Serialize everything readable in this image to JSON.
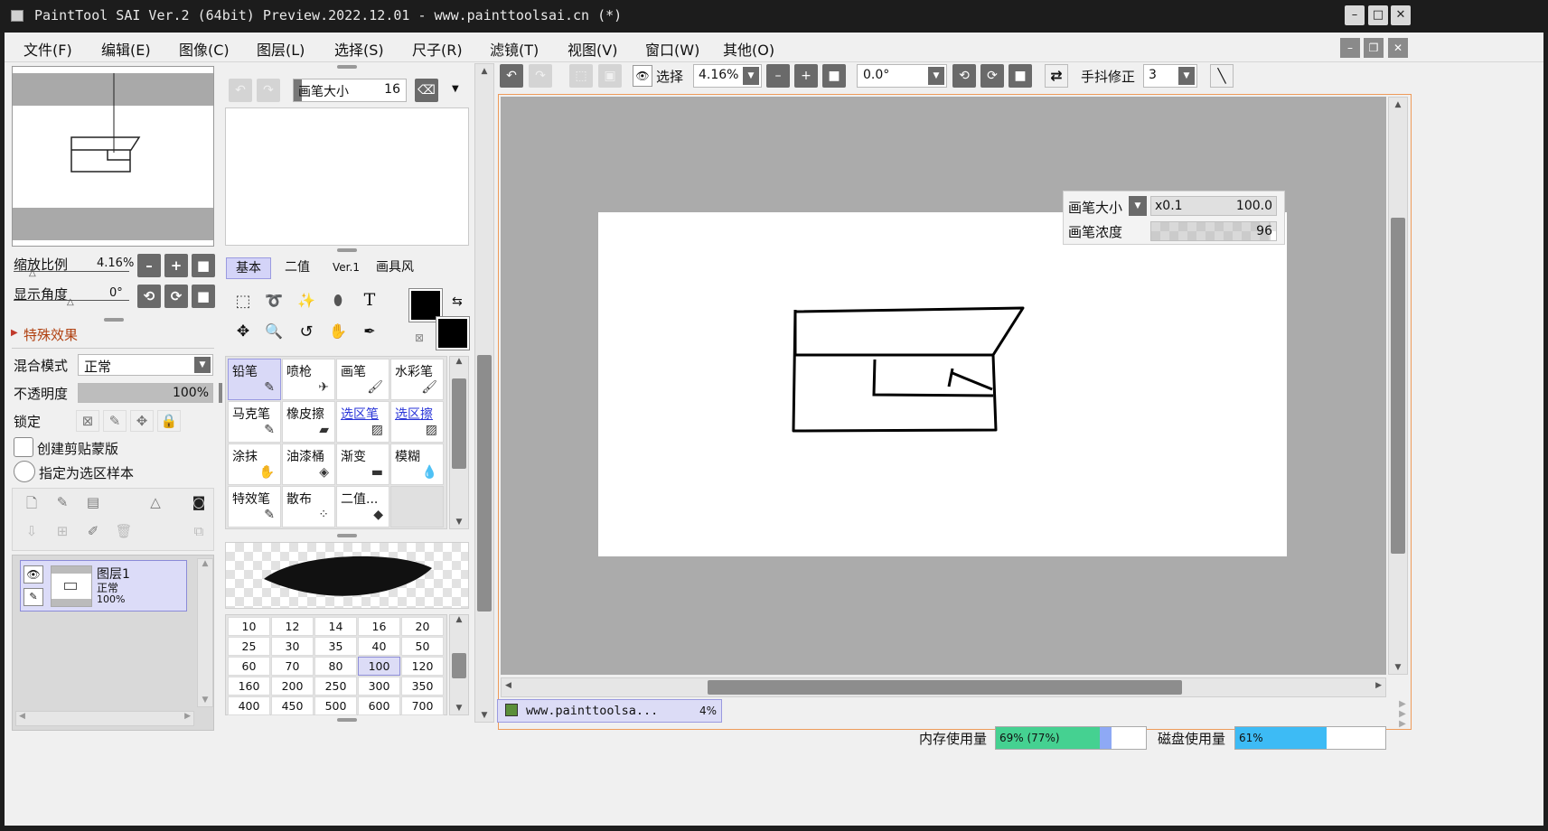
{
  "window": {
    "title": "PaintTool SAI Ver.2 (64bit) Preview.2022.12.01 - www.painttoolsai.cn (*)",
    "minimize": "–",
    "maximize": "□",
    "close": "✕"
  },
  "menu": [
    "文件(F)",
    "编辑(E)",
    "图像(C)",
    "图层(L)",
    "选择(S)",
    "尺子(R)",
    "滤镜(T)",
    "视图(V)",
    "窗口(W)",
    "其他(O)"
  ],
  "navigator": {
    "zoom_label": "缩放比例",
    "zoom_value": "4.16%",
    "angle_label": "显示角度",
    "angle_value": "0°"
  },
  "effects": {
    "label": "特殊效果"
  },
  "layer_props": {
    "blend_label": "混合模式",
    "blend_value": "正常",
    "opacity_label": "不透明度",
    "opacity_value": "100%",
    "opacity": 1.0,
    "lock_label": "锁定",
    "clip_label": "创建剪贴蒙版",
    "sample_label": "指定为选区样本"
  },
  "layers": [
    {
      "name": "图层1",
      "mode": "正常",
      "opacity": "100%"
    }
  ],
  "brush_panel": {
    "size_label": "画笔大小",
    "size_value": "16"
  },
  "tool_tabs": [
    "基本",
    "二值",
    "Ver.1",
    "画具风"
  ],
  "tools": [
    {
      "name": "铅笔",
      "icon": "✎"
    },
    {
      "name": "喷枪",
      "icon": "✈"
    },
    {
      "name": "画笔",
      "icon": "🖌"
    },
    {
      "name": "水彩笔",
      "icon": "🖌"
    },
    {
      "name": "马克笔",
      "icon": "✎"
    },
    {
      "name": "橡皮擦",
      "icon": "▰"
    },
    {
      "name": "选区笔",
      "icon": "▨"
    },
    {
      "name": "选区擦",
      "icon": "▨"
    },
    {
      "name": "涂抹",
      "icon": "✋"
    },
    {
      "name": "油漆桶",
      "icon": "◈"
    },
    {
      "name": "渐变",
      "icon": "▬"
    },
    {
      "name": "模糊",
      "icon": "💧"
    },
    {
      "name": "特效笔",
      "icon": "✎"
    },
    {
      "name": "散布",
      "icon": "⁘"
    },
    {
      "name": "二值...",
      "icon": "◆"
    }
  ],
  "brush_sizes": [
    "10",
    "12",
    "14",
    "16",
    "20",
    "25",
    "30",
    "35",
    "40",
    "50",
    "60",
    "70",
    "80",
    "100",
    "120",
    "160",
    "200",
    "250",
    "300",
    "350",
    "400",
    "450",
    "500",
    "600",
    "700"
  ],
  "toolbar": {
    "select_label": "选择",
    "zoom_value": "4.16%",
    "angle_value": "0.0°",
    "stabilizer_label": "手抖修正",
    "stabilizer_value": "3"
  },
  "overlay": {
    "size_label": "画笔大小",
    "size_mult": "x0.1",
    "size_value": "100.0",
    "density_label": "画笔浓度",
    "density_value": "96",
    "density": 0.96
  },
  "document_tab": {
    "name": "www.painttoolsa...",
    "zoom": "4%"
  },
  "status": {
    "mem_label": "内存使用量",
    "mem_value": "69% (77%)",
    "mem_fill": 0.69,
    "mem_fill_peak": 0.77,
    "disk_label": "磁盘使用量",
    "disk_value": "61%",
    "disk_fill": 0.61
  },
  "colors": {
    "accent": "#4d6fd6",
    "layer_sel": "#dcdcf8",
    "mem_bar": "#45d191",
    "mem_peak": "#8ea9f5",
    "disk_bar": "#3dbbf5",
    "canvas_border": "#ee9b5a"
  }
}
